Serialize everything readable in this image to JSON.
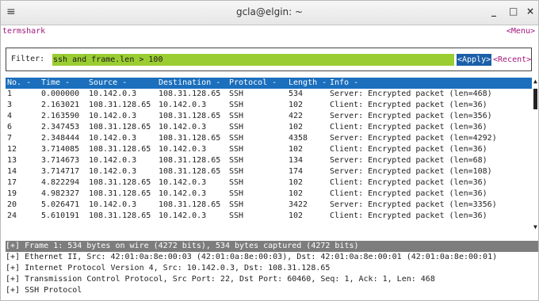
{
  "window": {
    "menu_glyph": "≡",
    "title": "gcla@elgin: ~",
    "minimize": "_",
    "maximize": "□",
    "close": "×"
  },
  "app": {
    "name": "termshark",
    "menu_label": "<Menu>"
  },
  "filter": {
    "label": "Filter:",
    "value": "ssh and frame.len > 100",
    "apply_label": "<Apply>",
    "recent_label": "<Recent>"
  },
  "packets": {
    "columns": [
      "No. -",
      "Time -",
      "Source -",
      "Destination -",
      "Protocol -",
      "Length -",
      "Info -"
    ],
    "rows": [
      [
        "1",
        "0.000000",
        "10.142.0.3",
        "108.31.128.65",
        "SSH",
        "534",
        "Server: Encrypted packet (len=468)"
      ],
      [
        "3",
        "2.163021",
        "108.31.128.65",
        "10.142.0.3",
        "SSH",
        "102",
        "Client: Encrypted packet (len=36)"
      ],
      [
        "4",
        "2.163590",
        "10.142.0.3",
        "108.31.128.65",
        "SSH",
        "422",
        "Server: Encrypted packet (len=356)"
      ],
      [
        "6",
        "2.347453",
        "108.31.128.65",
        "10.142.0.3",
        "SSH",
        "102",
        "Client: Encrypted packet (len=36)"
      ],
      [
        "7",
        "2.348444",
        "10.142.0.3",
        "108.31.128.65",
        "SSH",
        "4358",
        "Server: Encrypted packet (len=4292)"
      ],
      [
        "12",
        "3.714085",
        "108.31.128.65",
        "10.142.0.3",
        "SSH",
        "102",
        "Client: Encrypted packet (len=36)"
      ],
      [
        "13",
        "3.714673",
        "10.142.0.3",
        "108.31.128.65",
        "SSH",
        "134",
        "Server: Encrypted packet (len=68)"
      ],
      [
        "14",
        "3.714717",
        "10.142.0.3",
        "108.31.128.65",
        "SSH",
        "174",
        "Server: Encrypted packet (len=108)"
      ],
      [
        "17",
        "4.822294",
        "108.31.128.65",
        "10.142.0.3",
        "SSH",
        "102",
        "Client: Encrypted packet (len=36)"
      ],
      [
        "19",
        "4.982327",
        "108.31.128.65",
        "10.142.0.3",
        "SSH",
        "102",
        "Client: Encrypted packet (len=36)"
      ],
      [
        "20",
        "5.026471",
        "10.142.0.3",
        "108.31.128.65",
        "SSH",
        "3422",
        "Server: Encrypted packet (len=3356)"
      ],
      [
        "24",
        "5.610191",
        "108.31.128.65",
        "10.142.0.3",
        "SSH",
        "102",
        "Client: Encrypted packet (len=36)"
      ]
    ]
  },
  "details": {
    "lines": [
      "[+] Frame 1: 534 bytes on wire (4272 bits), 534 bytes captured (4272 bits)",
      "[+] Ethernet II, Src: 42:01:0a:8e:00:03 (42:01:0a:8e:00:03), Dst: 42:01:0a:8e:00:01 (42:01:0a:8e:00:01)",
      "[+] Internet Protocol Version 4, Src: 10.142.0.3, Dst: 108.31.128.65",
      "[+] Transmission Control Protocol, Src Port: 22, Dst Port: 60460, Seq: 1, Ack: 1, Len: 468",
      "[+] SSH Protocol"
    ]
  },
  "colors": {
    "accent_purple": "#a3177d",
    "filter_valid_green": "#9acd32",
    "header_blue": "#1b6fbd",
    "apply_blue": "#1b5fa8",
    "selected_detail_gray": "#7d7d7d"
  }
}
